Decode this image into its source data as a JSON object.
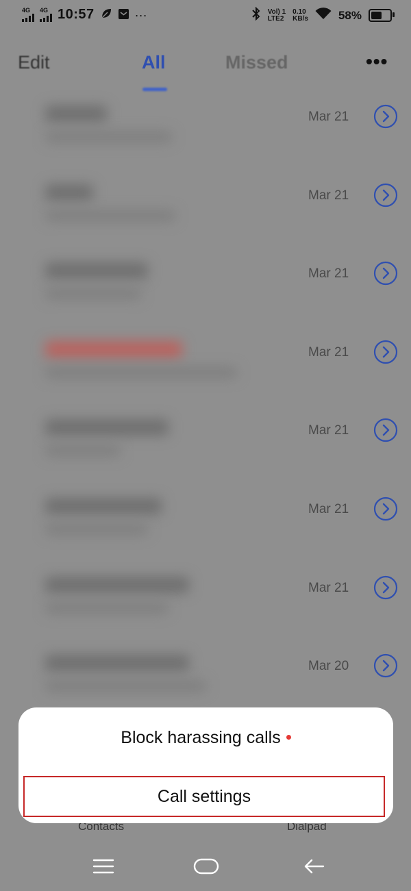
{
  "status_bar": {
    "sim1_label": "4G",
    "sim2_label": "4G",
    "time": "10:57",
    "icon_left_1": "leaf-icon",
    "icon_left_2": "message-icon",
    "more_dots": "···",
    "bluetooth_icon": "bluetooth-icon",
    "volte_top": "Vol) 1",
    "volte_bottom": "LTE2",
    "speed_top": "0.10",
    "speed_bottom": "KB/s",
    "wifi_icon": "wifi-icon",
    "battery_percent": "58%",
    "battery_level": 0.58
  },
  "header": {
    "edit_label": "Edit",
    "tab_all": "All",
    "tab_missed": "Missed",
    "more_label": "•••"
  },
  "calls": [
    {
      "date": "Mar 21"
    },
    {
      "date": "Mar 21"
    },
    {
      "date": "Mar 21"
    },
    {
      "date": "Mar 21"
    },
    {
      "date": "Mar 21"
    },
    {
      "date": "Mar 21"
    },
    {
      "date": "Mar 21"
    },
    {
      "date": "Mar 20"
    }
  ],
  "popup": {
    "item1": "Block harassing calls",
    "item2": "Call settings"
  },
  "bottom_tabs": {
    "contacts": "Contacts",
    "dialpad": "Dialpad"
  },
  "colors": {
    "accent": "#2f4fb0",
    "highlight_border": "#c62828",
    "badge_dot": "#e53935"
  }
}
